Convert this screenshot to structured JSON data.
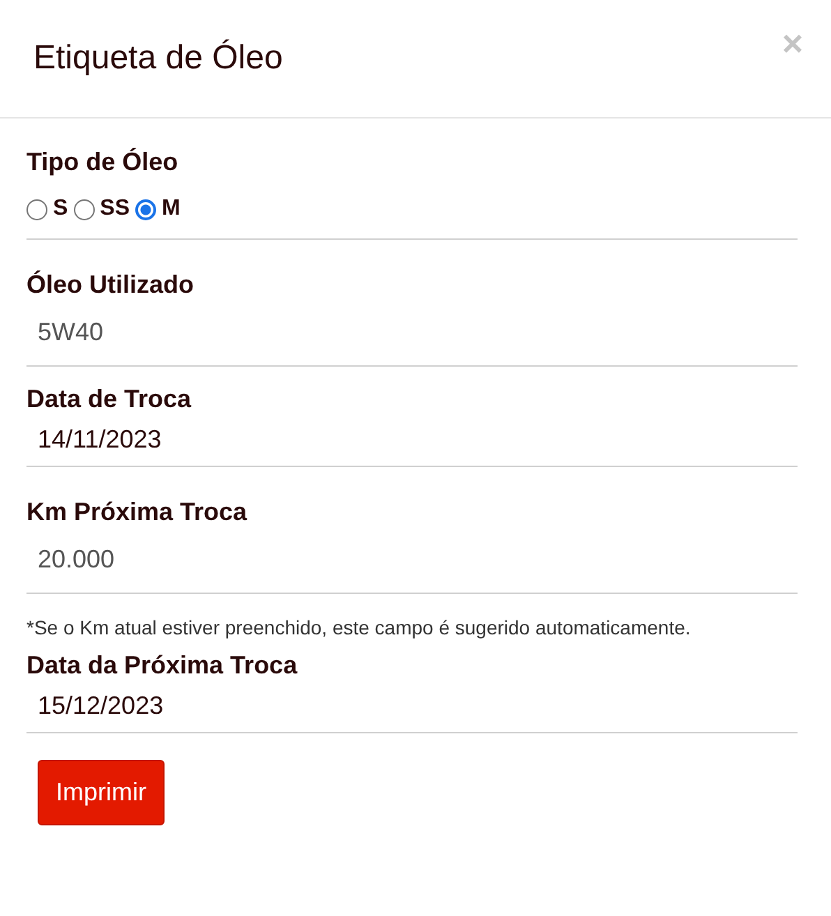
{
  "modal": {
    "title": "Etiqueta de Óleo",
    "close": "×"
  },
  "oil_type": {
    "label": "Tipo de Óleo",
    "options": [
      {
        "label": "S",
        "selected": false
      },
      {
        "label": "SS",
        "selected": false
      },
      {
        "label": "M",
        "selected": true
      }
    ]
  },
  "fields": [
    {
      "kind": "text",
      "label": "Óleo Utilizado",
      "value": "5W40"
    },
    {
      "kind": "date",
      "label": "Data de Troca",
      "value": "14/11/2023"
    },
    {
      "kind": "text",
      "label": "Km Próxima Troca",
      "value": "20.000",
      "note": "*Se o Km atual estiver preenchido, este campo é sugerido automaticamente."
    },
    {
      "kind": "date",
      "label": "Data da Próxima Troca",
      "value": "15/12/2023"
    }
  ],
  "button": "Imprimir"
}
